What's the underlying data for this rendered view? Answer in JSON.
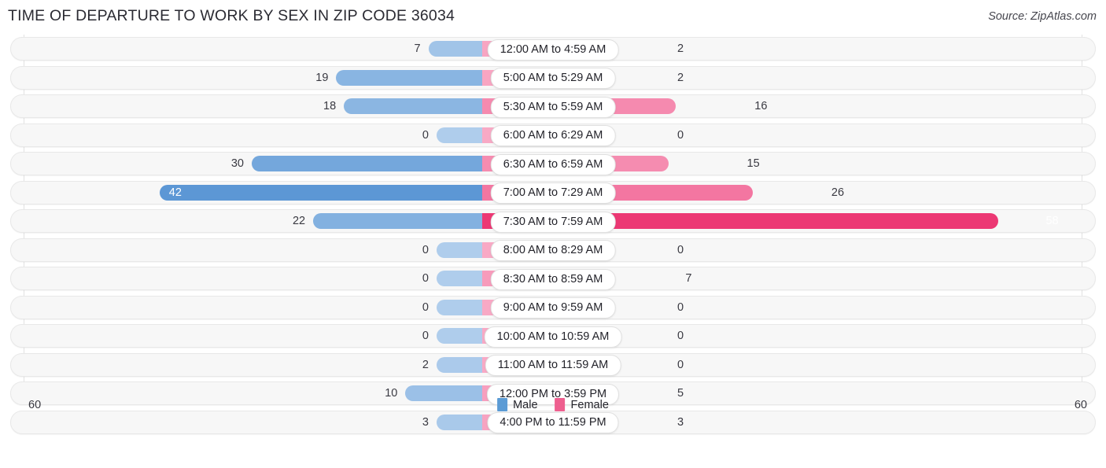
{
  "header": {
    "title": "TIME OF DEPARTURE TO WORK BY SEX IN ZIP CODE 36034",
    "source": "Source: ZipAtlas.com"
  },
  "legend": {
    "male_label": "Male",
    "female_label": "Female",
    "male_color": "#5b9bd5",
    "female_color": "#ee5f8f"
  },
  "axis": {
    "left_max": "60",
    "right_max": "60"
  },
  "chart_data": {
    "type": "bar",
    "title": "TIME OF DEPARTURE TO WORK BY SEX IN ZIP CODE 36034",
    "subtitle": "Source: ZipAtlas.com",
    "orientation": "horizontal-diverging",
    "xlabel": "",
    "ylabel": "",
    "xlim": [
      60,
      60
    ],
    "axis_max": 60,
    "grid": true,
    "legend_position": "bottom-center",
    "categories": [
      "12:00 AM to 4:59 AM",
      "5:00 AM to 5:29 AM",
      "5:30 AM to 5:59 AM",
      "6:00 AM to 6:29 AM",
      "6:30 AM to 6:59 AM",
      "7:00 AM to 7:29 AM",
      "7:30 AM to 7:59 AM",
      "8:00 AM to 8:29 AM",
      "8:30 AM to 8:59 AM",
      "9:00 AM to 9:59 AM",
      "10:00 AM to 10:59 AM",
      "11:00 AM to 11:59 AM",
      "12:00 PM to 3:59 PM",
      "4:00 PM to 11:59 PM"
    ],
    "series": [
      {
        "name": "Male",
        "color": "#5b9bd5",
        "values": [
          7,
          19,
          18,
          0,
          30,
          42,
          22,
          0,
          0,
          0,
          0,
          2,
          10,
          3
        ]
      },
      {
        "name": "Female",
        "color": "#ee5f8f",
        "values": [
          2,
          2,
          16,
          0,
          15,
          26,
          58,
          0,
          7,
          0,
          0,
          0,
          5,
          3
        ]
      }
    ]
  }
}
